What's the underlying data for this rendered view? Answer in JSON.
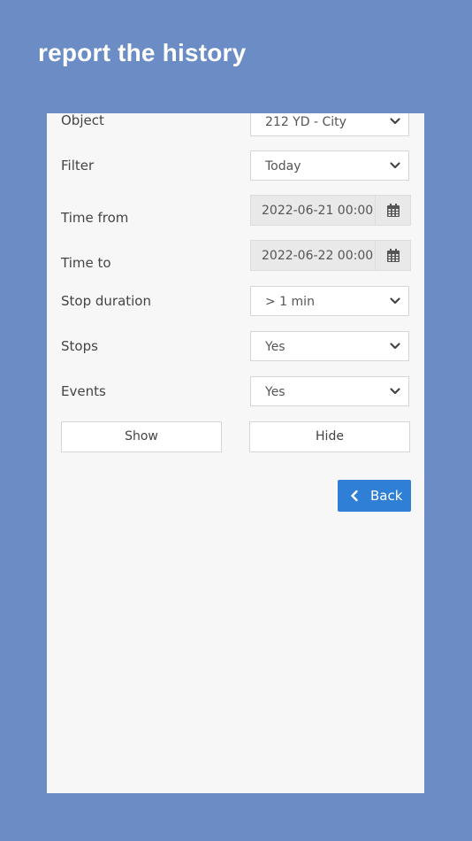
{
  "page": {
    "title": "report the history"
  },
  "form": {
    "object": {
      "label": "Object",
      "value": "212 YD - City"
    },
    "filter": {
      "label": "Filter",
      "value": "Today"
    },
    "time_from": {
      "label": "Time from",
      "value": "2022-06-21 00:00"
    },
    "time_to": {
      "label": "Time to",
      "value": "2022-06-22 00:00"
    },
    "stop_duration": {
      "label": "Stop duration",
      "value": "> 1 min"
    },
    "stops": {
      "label": "Stops",
      "value": "Yes"
    },
    "events": {
      "label": "Events",
      "value": "Yes"
    }
  },
  "actions": {
    "show_label": "Show",
    "hide_label": "Hide",
    "back_label": "Back"
  },
  "icons": {
    "calendar": "calendar-icon",
    "dropdown": "chevron-down-icon",
    "back": "chevron-left-icon"
  },
  "colors": {
    "background": "#6b8cc4",
    "panel": "#f7f7f7",
    "accent": "#2f7fd6"
  }
}
